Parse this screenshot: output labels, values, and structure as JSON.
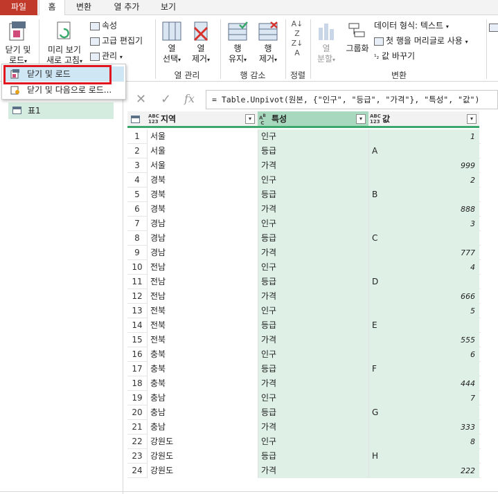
{
  "tabs": [
    {
      "label": "파일",
      "key": "file"
    },
    {
      "label": "홈",
      "key": "home"
    },
    {
      "label": "변환",
      "key": "transform"
    },
    {
      "label": "열 추가",
      "key": "add-column"
    },
    {
      "label": "보기",
      "key": "view"
    }
  ],
  "ribbon": {
    "close_load": {
      "line1": "닫기 및",
      "line2": "로드"
    },
    "preview": {
      "line1": "미리 보기",
      "line2": "새로 고침"
    },
    "properties": "속성",
    "advanced_editor": "고급 편집기",
    "manage": "관리",
    "choose_columns": {
      "line1": "열",
      "line2": "선택"
    },
    "remove_columns": {
      "line1": "열",
      "line2": "제거"
    },
    "keep_rows": {
      "line1": "행",
      "line2": "유지"
    },
    "remove_rows": {
      "line1": "행",
      "line2": "제거"
    },
    "split_column": {
      "line1": "열",
      "line2": "분할"
    },
    "group_by": "그룹화",
    "data_type": "데이터 형식: 텍스트",
    "first_row_header": "첫 행을 머리글로 사용",
    "replace_values": "값 바꾸기",
    "groups": {
      "manage_columns": "열 관리",
      "reduce_rows": "행 감소",
      "sort": "정렬",
      "transform": "변환"
    }
  },
  "dropdown": {
    "items": [
      "닫기 및 로드",
      "닫기 및 다음으로 로드..."
    ]
  },
  "queries": [
    {
      "name": "표1"
    }
  ],
  "formula": {
    "fx": "fx",
    "text": "= Table.Unpivot(원본, {\"인구\", \"등급\", \"가격\"}, \"특성\", \"값\")"
  },
  "grid": {
    "columns": [
      {
        "type_icon": "ABC\n123",
        "name": "지역"
      },
      {
        "type_icon": "A B\n C",
        "name": "특성"
      },
      {
        "type_icon": "ABC\n123",
        "name": "값"
      }
    ],
    "rows": [
      {
        "n": "1",
        "region": "서울",
        "attr": "인구",
        "value": "1",
        "is_num": true
      },
      {
        "n": "2",
        "region": "서울",
        "attr": "등급",
        "value": "A",
        "is_num": false
      },
      {
        "n": "3",
        "region": "서울",
        "attr": "가격",
        "value": "999",
        "is_num": true
      },
      {
        "n": "4",
        "region": "경북",
        "attr": "인구",
        "value": "2",
        "is_num": true
      },
      {
        "n": "5",
        "region": "경북",
        "attr": "등급",
        "value": "B",
        "is_num": false
      },
      {
        "n": "6",
        "region": "경북",
        "attr": "가격",
        "value": "888",
        "is_num": true
      },
      {
        "n": "7",
        "region": "경남",
        "attr": "인구",
        "value": "3",
        "is_num": true
      },
      {
        "n": "8",
        "region": "경남",
        "attr": "등급",
        "value": "C",
        "is_num": false
      },
      {
        "n": "9",
        "region": "경남",
        "attr": "가격",
        "value": "777",
        "is_num": true
      },
      {
        "n": "10",
        "region": "전남",
        "attr": "인구",
        "value": "4",
        "is_num": true
      },
      {
        "n": "11",
        "region": "전남",
        "attr": "등급",
        "value": "D",
        "is_num": false
      },
      {
        "n": "12",
        "region": "전남",
        "attr": "가격",
        "value": "666",
        "is_num": true
      },
      {
        "n": "13",
        "region": "전북",
        "attr": "인구",
        "value": "5",
        "is_num": true
      },
      {
        "n": "14",
        "region": "전북",
        "attr": "등급",
        "value": "E",
        "is_num": false
      },
      {
        "n": "15",
        "region": "전북",
        "attr": "가격",
        "value": "555",
        "is_num": true
      },
      {
        "n": "16",
        "region": "충북",
        "attr": "인구",
        "value": "6",
        "is_num": true
      },
      {
        "n": "17",
        "region": "충북",
        "attr": "등급",
        "value": "F",
        "is_num": false
      },
      {
        "n": "18",
        "region": "충북",
        "attr": "가격",
        "value": "444",
        "is_num": true
      },
      {
        "n": "19",
        "region": "충남",
        "attr": "인구",
        "value": "7",
        "is_num": true
      },
      {
        "n": "20",
        "region": "충남",
        "attr": "등급",
        "value": "G",
        "is_num": false
      },
      {
        "n": "21",
        "region": "충남",
        "attr": "가격",
        "value": "333",
        "is_num": true
      },
      {
        "n": "22",
        "region": "강원도",
        "attr": "인구",
        "value": "8",
        "is_num": true
      },
      {
        "n": "23",
        "region": "강원도",
        "attr": "등급",
        "value": "H",
        "is_num": false
      },
      {
        "n": "24",
        "region": "강원도",
        "attr": "가격",
        "value": "222",
        "is_num": true
      }
    ]
  },
  "colors": {
    "file_tab": "#c0392b",
    "highlight": "#e0141e",
    "selected_column": "#dff1e6",
    "header_accent": "#3aa86b"
  }
}
